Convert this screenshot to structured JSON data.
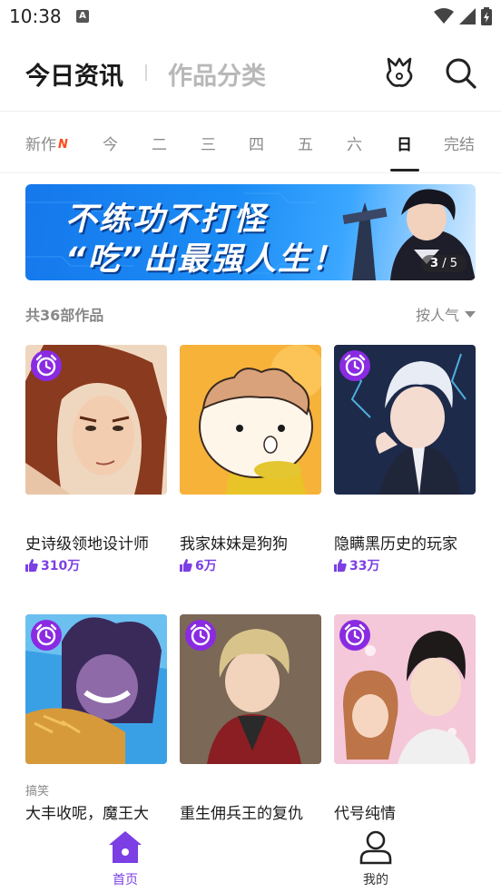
{
  "status": {
    "time": "10:38",
    "a_icon": "A"
  },
  "nav": {
    "active_title": "今日资讯",
    "inactive_title": "作品分类",
    "icons": [
      "badge-icon",
      "search-icon"
    ]
  },
  "tabs": [
    {
      "label": "新作",
      "badge": "N"
    },
    {
      "label": "今"
    },
    {
      "label": "二"
    },
    {
      "label": "三"
    },
    {
      "label": "四"
    },
    {
      "label": "五"
    },
    {
      "label": "六"
    },
    {
      "label": "日",
      "active": true
    },
    {
      "label": "完结"
    }
  ],
  "banner": {
    "line1": "不练功不打怪",
    "line2": "“吃”出最强人生！",
    "page_current": "3",
    "page_total": "/ 5"
  },
  "list": {
    "count": "共36部作品",
    "sort": "按人气"
  },
  "cards": [
    {
      "title": "史诗级领地设计师",
      "likes": "310万",
      "tag": ""
    },
    {
      "title": "我家妹妹是狗狗",
      "likes": "6万",
      "tag": ""
    },
    {
      "title": "隐瞒黑历史的玩家",
      "likes": "33万",
      "tag": ""
    },
    {
      "title": "大丰收呢，魔王大",
      "likes": "",
      "tag": "搞笑"
    },
    {
      "title": "重生佣兵王的复仇",
      "likes": "",
      "tag": ""
    },
    {
      "title": "代号纯情",
      "likes": "",
      "tag": ""
    }
  ],
  "bottom_nav": {
    "home": "首页",
    "mine": "我的"
  },
  "colors": {
    "accent": "#7b3fe4",
    "new_badge": "#ff4a1c",
    "banner_blue": "#1b8cf5"
  }
}
